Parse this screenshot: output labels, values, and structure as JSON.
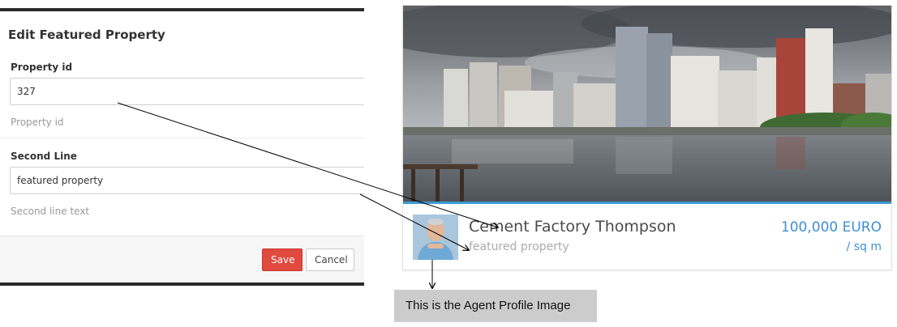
{
  "edit_panel": {
    "title": "Edit Featured Property",
    "fields": [
      {
        "label": "Property id",
        "value": "327",
        "help": "Property id"
      },
      {
        "label": "Second Line",
        "value": "featured property",
        "help": "Second line text"
      }
    ],
    "buttons": {
      "save": "Save",
      "cancel": "Cancel"
    }
  },
  "property_card": {
    "title": "Cement Factory Thompson",
    "subtitle": "featured property",
    "price": "100,000 EURO",
    "unit": "/ sq m",
    "accent_color": "#3f9ad6"
  },
  "annotation": {
    "text": "This is the Agent Profile Image"
  }
}
